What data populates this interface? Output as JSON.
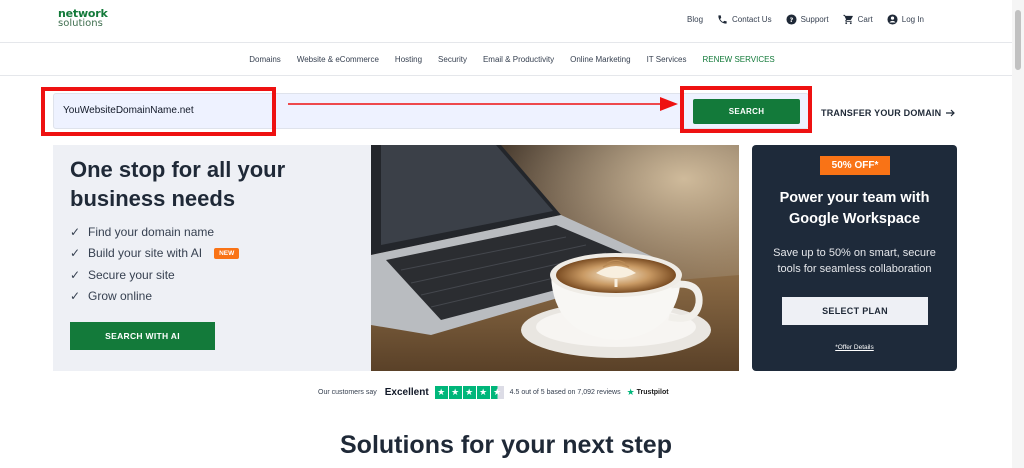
{
  "header": {
    "logo_line1": "network",
    "logo_line2": "solutions",
    "utility": {
      "blog": "Blog",
      "contact": "Contact Us",
      "support": "Support",
      "cart": "Cart",
      "login": "Log In"
    }
  },
  "nav": {
    "items": [
      "Domains",
      "Website & eCommerce",
      "Hosting",
      "Security",
      "Email & Productivity",
      "Online Marketing",
      "IT Services",
      "RENEW SERVICES"
    ]
  },
  "search": {
    "value": "YouWebsiteDomainName.net",
    "button_label": "SEARCH",
    "transfer_label": "TRANSFER YOUR DOMAIN"
  },
  "hero": {
    "title": "One stop for all your business needs",
    "features": [
      "Find your domain name",
      "Build your site with AI",
      "Secure your site",
      "Grow online"
    ],
    "new_badge": "NEW",
    "button_label": "SEARCH WITH AI",
    "check_glyph": "✓"
  },
  "promo": {
    "badge": "50% OFF*",
    "title": "Power your team with Google Workspace",
    "description": "Save up to 50% on smart, secure tools for seamless collaboration",
    "button_label": "SELECT PLAN",
    "offer_link": "*Offer Details"
  },
  "trust": {
    "prefix": "Our customers say",
    "rating_word": "Excellent",
    "rating_text": "4.5 out of 5 based on 7,092 reviews",
    "brand": "Trustpilot",
    "rating": 4.5
  },
  "solutions_title": "Solutions for your next step",
  "colors": {
    "brand_green": "#137a3a",
    "accent_orange": "#f97316",
    "promo_bg": "#1e2a3a",
    "annotation_red": "#ee1111",
    "trustpilot_green": "#00b67a"
  }
}
